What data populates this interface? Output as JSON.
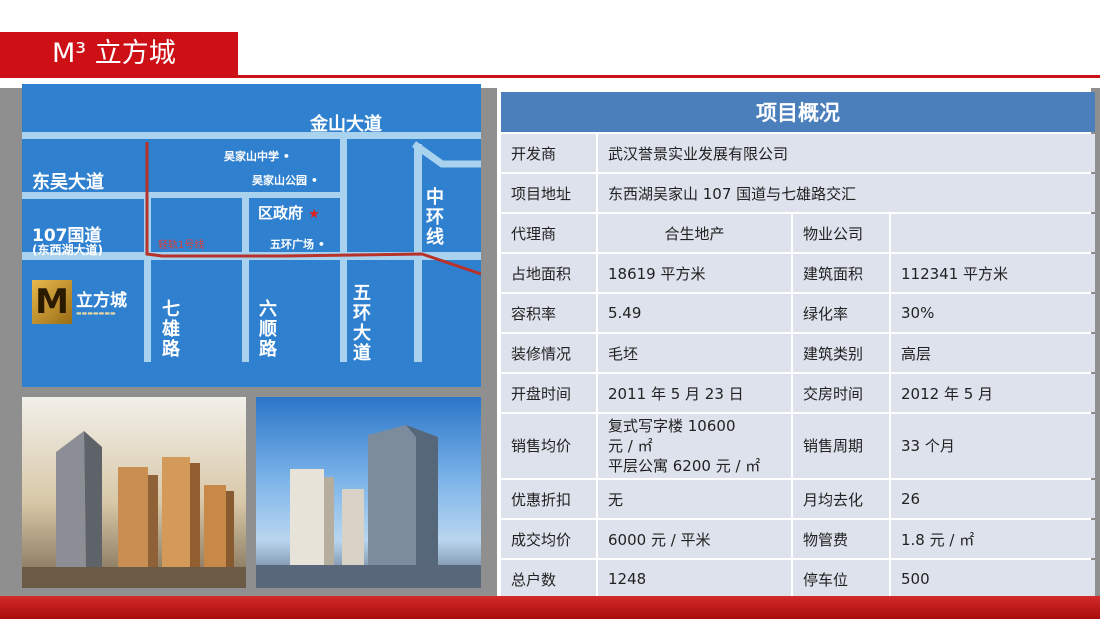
{
  "page": {
    "title": "M³ 立方城"
  },
  "map": {
    "roads": {
      "jinshan": "金山大道",
      "dongwu": "东吴大道",
      "g107": "107国道",
      "g107_sub": "(东西湖大道)",
      "qixiong": "七雄路",
      "liushun": "六顺路",
      "wuhuan": "五环大道",
      "zhonghuan": "中环线"
    },
    "pois": {
      "school": "吴家山中学",
      "park": "吴家山公园",
      "gov": "区政府",
      "plaza": "五环广场"
    },
    "metro": "轻轨1号线",
    "logo": {
      "mark": "M",
      "text": "立方城"
    }
  },
  "panel": {
    "header": "项目概况",
    "rows": [
      {
        "label": "开发商",
        "value": "武汉誉景实业发展有限公司"
      },
      {
        "label": "项目地址",
        "value": "东西湖吴家山 107 国道与七雄路交汇"
      },
      {
        "label": "代理商",
        "value": "合生地产",
        "label2": "物业公司",
        "value2": ""
      },
      {
        "label": "占地面积",
        "value": "18619 平方米",
        "label2": "建筑面积",
        "value2": "112341 平方米"
      },
      {
        "label": "容积率",
        "value": "5.49",
        "label2": "绿化率",
        "value2": "30%"
      },
      {
        "label": "装修情况",
        "value": "毛坯",
        "label2": "建筑类别",
        "value2": "高层"
      },
      {
        "label": "开盘时间",
        "value": "2011 年 5 月 23 日",
        "label2": "交房时间",
        "value2": "2012 年 5 月"
      },
      {
        "label": "销售均价",
        "value_lines": [
          "复式写字楼 10600",
          "元 / ㎡",
          "平层公寓 6200 元 / ㎡"
        ],
        "label2": "销售周期",
        "value2": "33 个月"
      },
      {
        "label": "优惠折扣",
        "value": "无",
        "label2": "月均去化",
        "value2": "26"
      },
      {
        "label": "成交均价",
        "value": "6000 元 / 平米",
        "label2": "物管费",
        "value2": "1.8 元 / ㎡"
      },
      {
        "label": "总户数",
        "value": "1248",
        "label2": "停车位",
        "value2": "500"
      }
    ]
  },
  "colors": {
    "accent": "#cc1016",
    "table_header": "#4a7fbc",
    "table_cell": "#dde2ec",
    "map_blue": "#2f80cf",
    "road": "#a9d2ee"
  }
}
